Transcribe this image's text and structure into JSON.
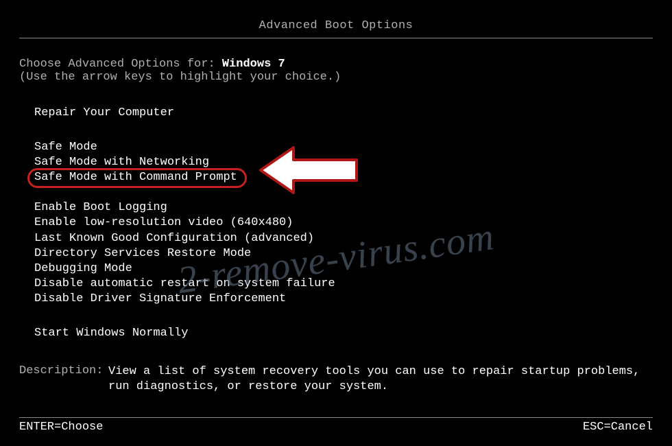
{
  "title": "Advanced Boot Options",
  "intro": {
    "prefix": "Choose Advanced Options for: ",
    "os_name": "Windows 7"
  },
  "hint": "(Use the arrow keys to highlight your choice.)",
  "groups": {
    "repair": {
      "items": [
        "Repair Your Computer"
      ]
    },
    "safe": {
      "items": [
        "Safe Mode",
        "Safe Mode with Networking",
        "Safe Mode with Command Prompt"
      ]
    },
    "advanced": {
      "items": [
        "Enable Boot Logging",
        "Enable low-resolution video (640x480)",
        "Last Known Good Configuration (advanced)",
        "Directory Services Restore Mode",
        "Debugging Mode",
        "Disable automatic restart on system failure",
        "Disable Driver Signature Enforcement"
      ]
    },
    "normal": {
      "items": [
        "Start Windows Normally"
      ]
    }
  },
  "description": {
    "label": "Description:",
    "text": "View a list of system recovery tools you can use to repair startup problems, run diagnostics, or restore your system."
  },
  "footer": {
    "enter": "ENTER=Choose",
    "esc": "ESC=Cancel"
  },
  "watermark": "2-remove-virus.com",
  "highlighted_index": 2,
  "colors": {
    "highlight_ring": "#c62020",
    "arrow_fill": "#ffffff",
    "arrow_stroke": "#b01818"
  }
}
